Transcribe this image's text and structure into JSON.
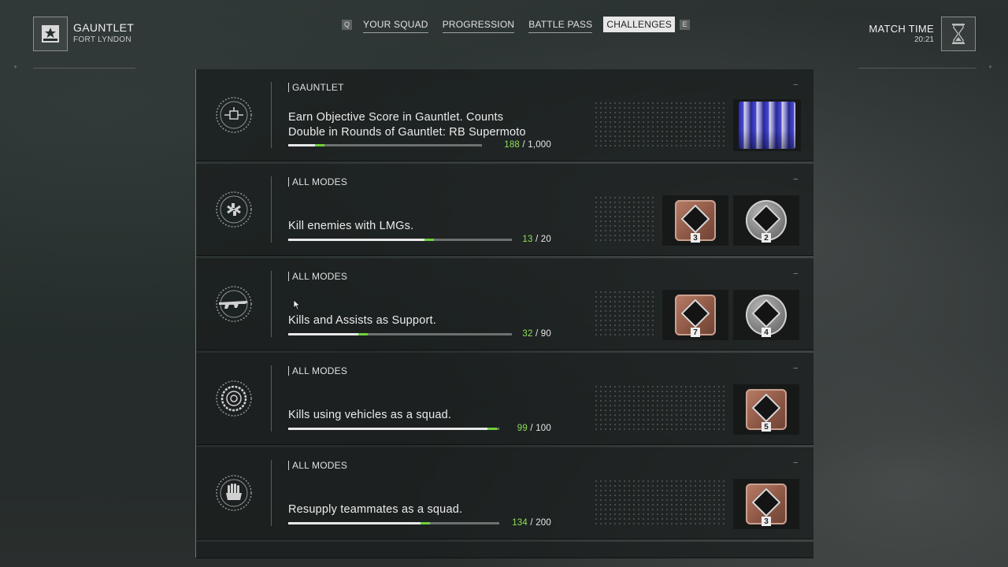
{
  "header": {
    "mode_title": "GAUNTLET",
    "mode_subtitle": "FORT LYNDON",
    "tabs": {
      "left_key": "Q",
      "right_key": "E",
      "items": [
        "YOUR SQUAD",
        "PROGRESSION",
        "BATTLE PASS",
        "CHALLENGES"
      ],
      "active": "CHALLENGES"
    },
    "match_time_label": "MATCH TIME",
    "match_time_value": "20:21"
  },
  "challenges": [
    {
      "category": "GAUNTLET",
      "icon": "objective-icon",
      "description_line1": "Earn Objective Score in Gauntlet. Counts",
      "description_line2": "Double in Rounds of Gauntlet: RB Supermoto",
      "current": "188",
      "total": "1,000",
      "progress_fraction": 0.188,
      "rewards": [
        {
          "type": "vehicle-skin",
          "icon": "vehicle-skin-icon"
        }
      ]
    },
    {
      "category": "ALL MODES",
      "icon": "lmg-icon",
      "description_line1": "Kill enemies with LMGs.",
      "description_line2": "",
      "current": "13",
      "total": "20",
      "progress_fraction": 0.65,
      "rewards": [
        {
          "type": "bronze",
          "count": "3",
          "icon": "bronze-token-icon"
        },
        {
          "type": "silver",
          "count": "2",
          "icon": "silver-token-icon"
        }
      ]
    },
    {
      "category": "ALL MODES",
      "icon": "support-rifle-icon",
      "description_line1": "Kills and Assists as Support.",
      "description_line2": "",
      "current": "32",
      "total": "90",
      "progress_fraction": 0.356,
      "rewards": [
        {
          "type": "bronze",
          "count": "7",
          "icon": "bronze-token-icon"
        },
        {
          "type": "silver",
          "count": "4",
          "icon": "silver-token-icon"
        }
      ]
    },
    {
      "category": "ALL MODES",
      "icon": "vehicle-wheel-icon",
      "description_line1": "Kills using vehicles as a squad.",
      "description_line2": "",
      "current": "99",
      "total": "100",
      "progress_fraction": 0.99,
      "rewards": [
        {
          "type": "bronze",
          "count": "5",
          "icon": "bronze-token-icon"
        }
      ]
    },
    {
      "category": "ALL MODES",
      "icon": "resupply-hand-icon",
      "description_line1": "Resupply teammates as a squad.",
      "description_line2": "",
      "current": "134",
      "total": "200",
      "progress_fraction": 0.67,
      "rewards": [
        {
          "type": "bronze",
          "count": "3",
          "icon": "bronze-token-icon"
        }
      ]
    }
  ],
  "colors": {
    "progress_green": "#6fd23a",
    "progress_white": "#e8e8e8",
    "bronze": "#8a5543",
    "silver": "#7c7c7c"
  }
}
